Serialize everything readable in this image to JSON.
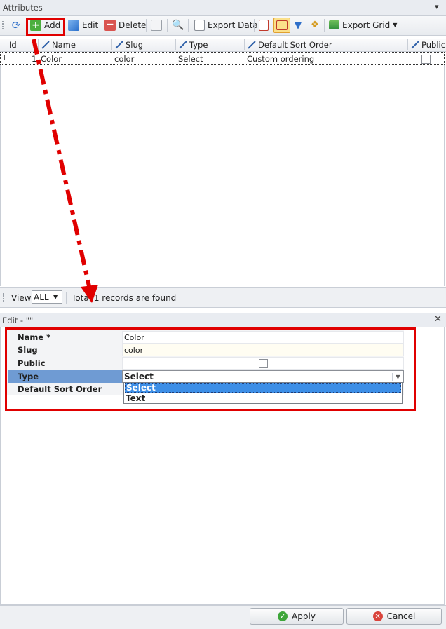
{
  "attributes_panel": {
    "title": "Attributes"
  },
  "toolbar": {
    "add_label": "Add",
    "edit_label": "Edit",
    "delete_label": "Delete",
    "export_data_label": "Export Data",
    "export_grid_label": "Export Grid"
  },
  "grid": {
    "columns": [
      "Id",
      "Name",
      "Slug",
      "Type",
      "Default Sort Order",
      "Public"
    ],
    "rows": [
      {
        "id": "1",
        "name": "Color",
        "slug": "color",
        "type": "Select",
        "default_sort_order": "Custom ordering",
        "public": false
      }
    ]
  },
  "footer": {
    "view_label": "View",
    "view_value": "ALL",
    "records_text": "Total 1 records are found"
  },
  "edit_panel": {
    "title": "Edit - \"\"",
    "fields": {
      "name_label": "Name *",
      "name_value": "Color",
      "slug_label": "Slug",
      "slug_value": "color",
      "public_label": "Public",
      "type_label": "Type",
      "type_value": "Select",
      "default_sort_label": "Default Sort Order"
    },
    "type_options": [
      "Select",
      "Text"
    ],
    "apply_label": "Apply",
    "cancel_label": "Cancel"
  },
  "colors": {
    "highlight_red": "#e00000",
    "selection_blue": "#3d8ee6",
    "row_select": "#6f9bd3"
  }
}
